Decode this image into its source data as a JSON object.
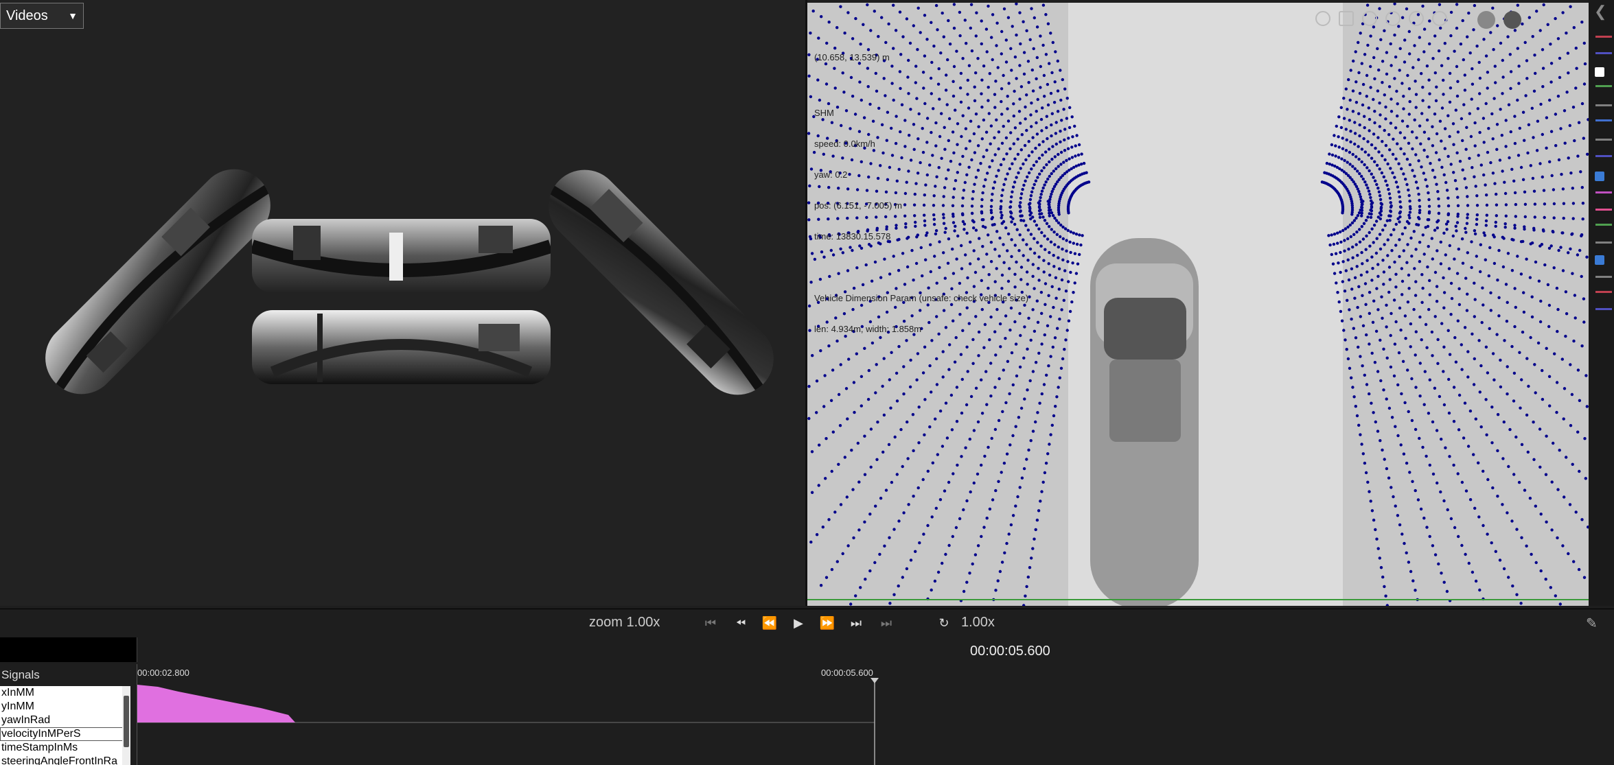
{
  "video_panel": {
    "source_select": "Videos"
  },
  "map": {
    "info": {
      "coords": "(10.658, 13.539) m",
      "mode": "SHM",
      "speed": "speed: 0.0km/h",
      "yaw": "yaw: 0.2",
      "pos": "pos: (6.151, -7.005) m",
      "time": "time: 13830.15.578",
      "vehicle_param": "Vehicle Dimension Param (unsafe: check vehicle size)",
      "vehicle_size": "len: 4.934m, width: 1.858m"
    },
    "colors": {
      "points": "#00008b",
      "background": "#d3d3d3",
      "baseline": "#3a9a3a"
    }
  },
  "legend_colors": [
    "#c04050",
    "#5050c0",
    "#50a050",
    "#808080",
    "#4070d0",
    "#808080",
    "#5050c0",
    "#c050c0",
    "#e05090",
    "#50a050",
    "#808080",
    "#808080"
  ],
  "playbar": {
    "zoom": "zoom 1.00x",
    "speed": "1.00x",
    "buttons": [
      "first",
      "prev-frame",
      "rewind",
      "play",
      "fast-forward",
      "next-frame",
      "last"
    ]
  },
  "timeline": {
    "current_time": "00:00:05.600",
    "start_label": "00:00:02.800",
    "cursor_label": "00:00:05.600"
  },
  "signals": {
    "title": "Signals",
    "items": [
      "xInMM",
      "yInMM",
      "yawInRad",
      "velocityInMPerS",
      "timeStampInMs",
      "steeringAngleFrontInRa"
    ],
    "selected": "velocityInMPerS"
  },
  "graph": {
    "fill_color": "#e070e0"
  }
}
